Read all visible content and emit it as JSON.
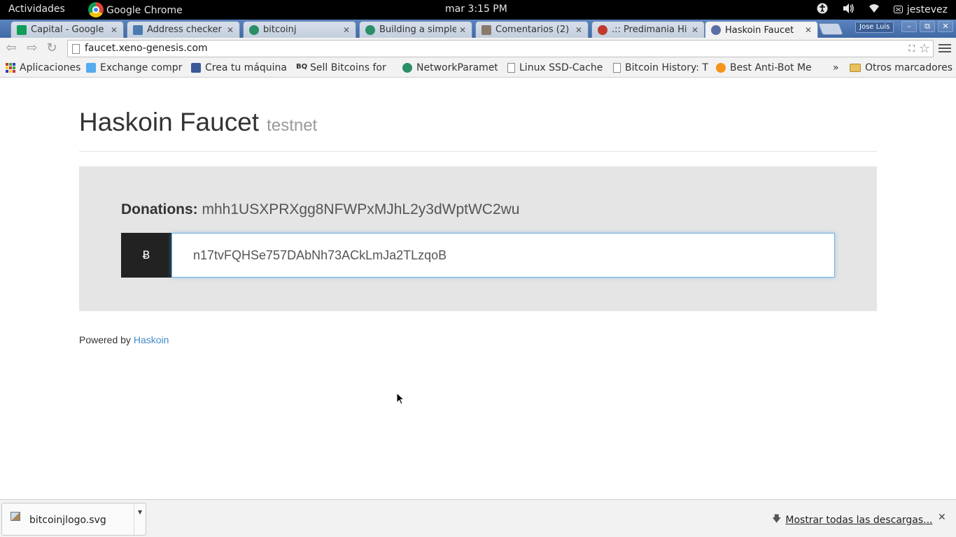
{
  "topbar": {
    "activities": "Actividades",
    "app_name": "Google Chrome",
    "clock": "mar  3:15 PM",
    "user": "jestevez"
  },
  "tabs": [
    {
      "label": "Capital - Google",
      "favicon_color": "#0f9d58"
    },
    {
      "label": "Address checker",
      "favicon_color": "#4a7ab0"
    },
    {
      "label": "bitcoinj",
      "favicon_color": "#2a8f66"
    },
    {
      "label": "Building a simple",
      "favicon_color": "#2a8f66"
    },
    {
      "label": "Comentarios (2)",
      "favicon_color": "#8a7a6a"
    },
    {
      "label": ".:: Predimania Hi",
      "favicon_color": "#c0392b"
    },
    {
      "label": "Haskoin Faucet",
      "favicon_color": "#5b6fa5"
    }
  ],
  "profile": "Jose Luis",
  "toolbar": {
    "url": "faucet.xeno-genesis.com"
  },
  "bookmarks": [
    {
      "label": "Aplicaciones",
      "icon": "apps-icon"
    },
    {
      "label": "Exchange compra",
      "icon": "bird-icon"
    },
    {
      "label": "Crea tu máquina d",
      "icon": "facebook-icon"
    },
    {
      "label": "Sell Bitcoins for",
      "icon": "bq-icon"
    },
    {
      "label": "NetworkParamet",
      "icon": "bitcoinj-icon"
    },
    {
      "label": "Linux SSD-Cache",
      "icon": "file-icon"
    },
    {
      "label": "Bitcoin History: T",
      "icon": "file-icon"
    },
    {
      "label": "Best Anti-Bot Me",
      "icon": "bitcoin-icon"
    }
  ],
  "bookmarks_overflow": "»",
  "other_bookmarks": "Otros marcadores",
  "page": {
    "title": "Haskoin Faucet",
    "subtitle": "testnet",
    "donations_label": "Donations:",
    "donations_address": "mhh1USXPRXgg8NFWPxMJhL2y3dWptWC2wu",
    "currency_symbol": "Ƀ",
    "address_value": "n17tvFQHSe757DAbNh73ACkLmJa2TLzqoB",
    "powered_by": "Powered by",
    "powered_link": "Haskoin"
  },
  "download": {
    "file": "bitcoinjlogo.svg",
    "show_all": "Mostrar todas las descargas..."
  },
  "colors": {
    "link": "#428bca",
    "panel": "#e5e5e5",
    "addon": "#222222"
  }
}
